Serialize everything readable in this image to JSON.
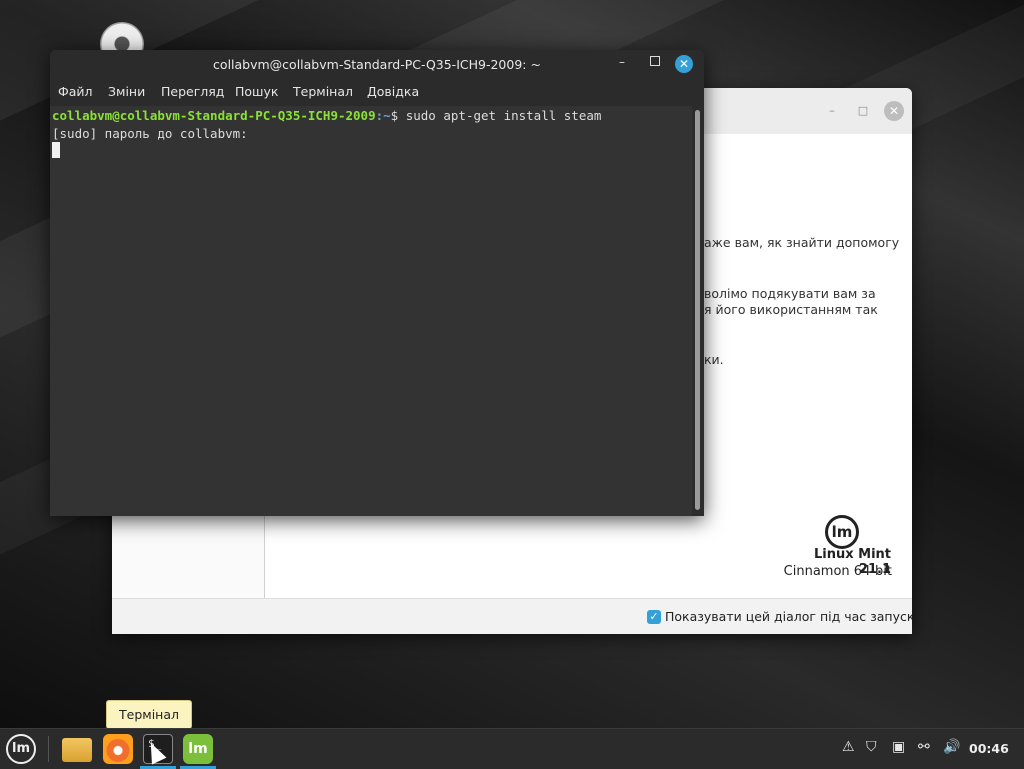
{
  "terminal": {
    "title": "collabvm@collabvm-Standard-PC-Q35-ICH9-2009: ~",
    "menu": [
      "Файл",
      "Зміни",
      "Перегляд",
      "Пошук",
      "Термінал",
      "Довідка"
    ],
    "prompt_user": "collabvm@collabvm-Standard-PC-Q35-ICH9-2009",
    "prompt_path": ":~",
    "prompt_symbol": "$ ",
    "command": "sudo apt-get install steam",
    "output_line": "[sudo] пароль до collabvm:"
  },
  "welcome": {
    "paragraphs": [
      "аже вам, як знайти допомогу",
      "волімо подякувати вам за",
      "я його використанням так",
      "ки."
    ],
    "version_title": "Linux Mint 21.1",
    "version_sub": "Cinnamon 64-bit",
    "logo_text": "lm",
    "show_on_startup_label": "Показувати цей діалог під час запуску"
  },
  "tooltip": {
    "text": "Термінал"
  },
  "taskbar": {
    "clock": "00:46"
  },
  "colors": {
    "accent": "#35a0d8",
    "prompt_user": "#8ae234",
    "prompt_path": "#729fcf"
  }
}
